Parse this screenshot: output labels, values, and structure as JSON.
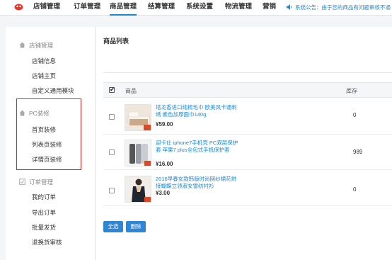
{
  "nav": {
    "items": [
      {
        "label": "店铺管理"
      },
      {
        "label": "订单管理"
      },
      {
        "label": "商品管理",
        "active": true
      },
      {
        "label": "结算管理"
      },
      {
        "label": "系统设置"
      },
      {
        "label": "物流管理"
      },
      {
        "label": "营销"
      }
    ],
    "notice_prefix": "系统公告：",
    "notice_text": "由于您的商品有问题审核不通"
  },
  "sidebar": {
    "groups": [
      {
        "title": "店铺管理",
        "icon": "home-icon",
        "items": [
          "店铺信息",
          "店铺主页",
          "自定义通用模块"
        ]
      },
      {
        "title": "PC装修",
        "icon": "home-icon",
        "items": [
          "首页装修",
          "列表页装修",
          "详情页装修"
        ]
      },
      {
        "title": "订单管理",
        "icon": "checkbox-icon",
        "items": [
          "我的订单",
          "导出订单",
          "批量发货",
          "退换货审核"
        ]
      }
    ]
  },
  "main": {
    "title": "商品列表",
    "columns": {
      "product": "商品",
      "stock": "库存"
    },
    "rows": [
      {
        "name": "塔龙香进口纯棉毛巾 欧美风卡通刺绣 素色加厚面巾140g",
        "price": "¥59.00",
        "stock": "0"
      },
      {
        "name": "迎卡仕 iphone7手机壳 PC双层保护套 苹果7 plus全包式手机保护套",
        "price": "¥16.00",
        "stock": "989"
      },
      {
        "name": "2016早春女款韩版时尚网纱裙花拼接蝴蝶立领淑女雪纺衬衫",
        "price": "¥3.00",
        "stock": "0"
      }
    ],
    "buttons": {
      "select_all": "全选",
      "delete": "删除"
    }
  },
  "colors": {
    "accent": "#1e88d4",
    "highlight_border": "#e0221e",
    "button": "#2f86d6"
  }
}
